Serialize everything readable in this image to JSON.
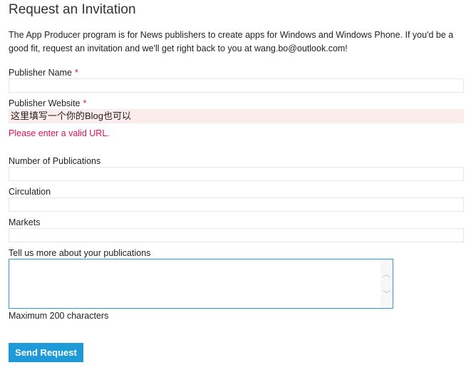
{
  "title": "Request an Invitation",
  "intro": "The App Producer program is for News publishers to create apps for Windows and Windows Phone. If you'd be a good fit, request an invitation and we'll get right back to you at wang.bo@outlook.com!",
  "fields": {
    "publisher_name": {
      "label": "Publisher Name",
      "required": "*",
      "value": ""
    },
    "publisher_website": {
      "label": "Publisher Website",
      "required": "*",
      "value": "这里填写一个你的Blog也可以",
      "error": "Please enter a valid URL."
    },
    "num_publications": {
      "label": "Number of Publications",
      "value": ""
    },
    "circulation": {
      "label": "Circulation",
      "value": ""
    },
    "markets": {
      "label": "Markets",
      "value": ""
    },
    "more": {
      "label": "Tell us more about your publications",
      "hint": "Maximum 200 characters"
    }
  },
  "submit_label": "Send Request",
  "accent": "#1e9ad8"
}
